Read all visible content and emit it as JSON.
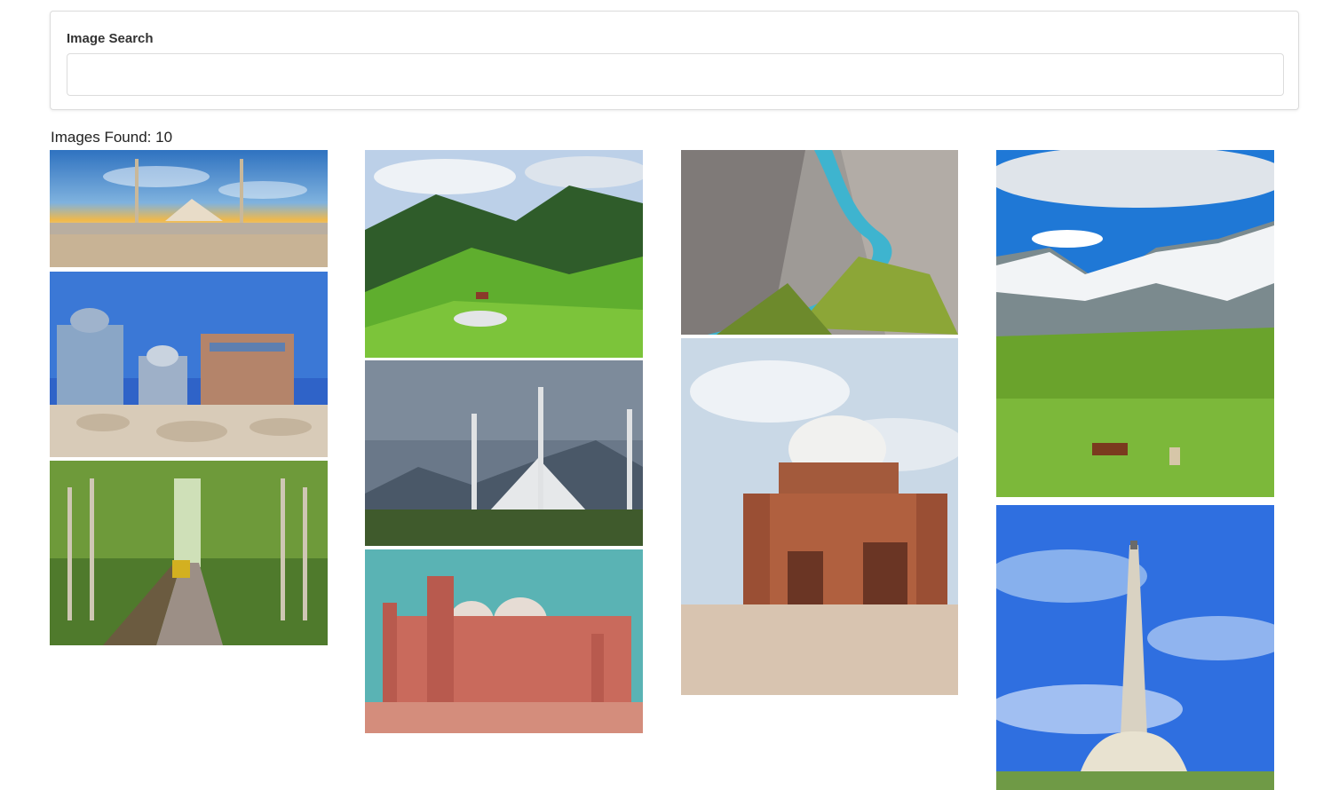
{
  "search": {
    "label": "Image Search",
    "value": "",
    "placeholder": ""
  },
  "results": {
    "count_label": "Images Found: 10"
  },
  "images": [
    {
      "id": "faisal-mosque-sunset",
      "subject": "Faisal Mosque at sunset with reflection"
    },
    {
      "id": "green-meadow-hills",
      "subject": "Green hills with pine forest"
    },
    {
      "id": "hunza-river-valley",
      "subject": "River valley between rocky mountains"
    },
    {
      "id": "snowy-mountain-meadow",
      "subject": "Snowy mountains with horses grazing on meadow"
    },
    {
      "id": "makli-tombs",
      "subject": "Blue-tiled ancient tombs on desert mounds"
    },
    {
      "id": "faisal-mosque-cloudy",
      "subject": "Faisal Mosque under cloudy sky"
    },
    {
      "id": "multan-shrine",
      "subject": "Brick shrine with white dome"
    },
    {
      "id": "tree-lined-road",
      "subject": "Road through tall trees with rickshaw"
    },
    {
      "id": "badshahi-mosque",
      "subject": "Red sandstone mosque with white domes"
    },
    {
      "id": "minar-e-pakistan",
      "subject": "Minar-e-Pakistan tower against blue sky"
    }
  ]
}
